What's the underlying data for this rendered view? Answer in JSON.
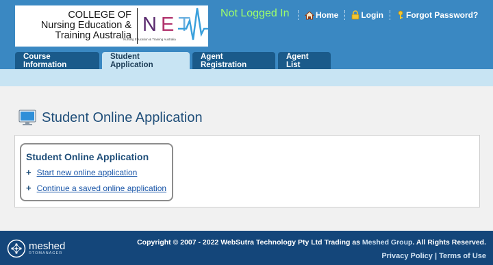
{
  "header": {
    "logo": {
      "college_lines": [
        "COLLEGE OF",
        "Nursing Education &",
        "Training Australia"
      ],
      "net_letters": [
        "N",
        "E",
        "T"
      ],
      "net_sub": "Nursing Education & Training Australia"
    },
    "login_status": "Not Logged In",
    "links": [
      {
        "label": "Home",
        "icon": "home-icon"
      },
      {
        "label": "Login",
        "icon": "lock-icon"
      },
      {
        "label": "Forgot Password?",
        "icon": "key-icon"
      }
    ],
    "tabs": [
      {
        "label": "Course Information",
        "active": false
      },
      {
        "label": "Student Application",
        "active": true
      },
      {
        "label": "Agent Registration",
        "active": false
      },
      {
        "label": "Agent List",
        "active": false
      }
    ]
  },
  "main": {
    "title": "Student Online Application",
    "title_icon": "monitor-icon",
    "card": {
      "title": "Student Online Application",
      "links": [
        {
          "label": "Start new online application"
        },
        {
          "label": "Continue a saved online application"
        }
      ]
    }
  },
  "footer": {
    "brand_name": "meshed",
    "brand_sub": "RTOMANAGER",
    "copyright_prefix": "Copyright © 2007 - 2022 WebSutra Technology Pty Ltd Trading as ",
    "copyright_brand": "Meshed Group",
    "copyright_suffix": ". All Rights Reserved.",
    "privacy": "Privacy Policy",
    "link_sep": "|",
    "terms": "Terms of Use"
  },
  "colors": {
    "header_bg": "#3a88c2",
    "tab_bg": "#1a5a8a",
    "tab_active_bg": "#c8e4f3",
    "subbar_bg": "#c8e4f3",
    "login_status": "#9fff6a",
    "title": "#1f4e79",
    "link": "#1a56a8",
    "footer_bg": "#14467a"
  }
}
